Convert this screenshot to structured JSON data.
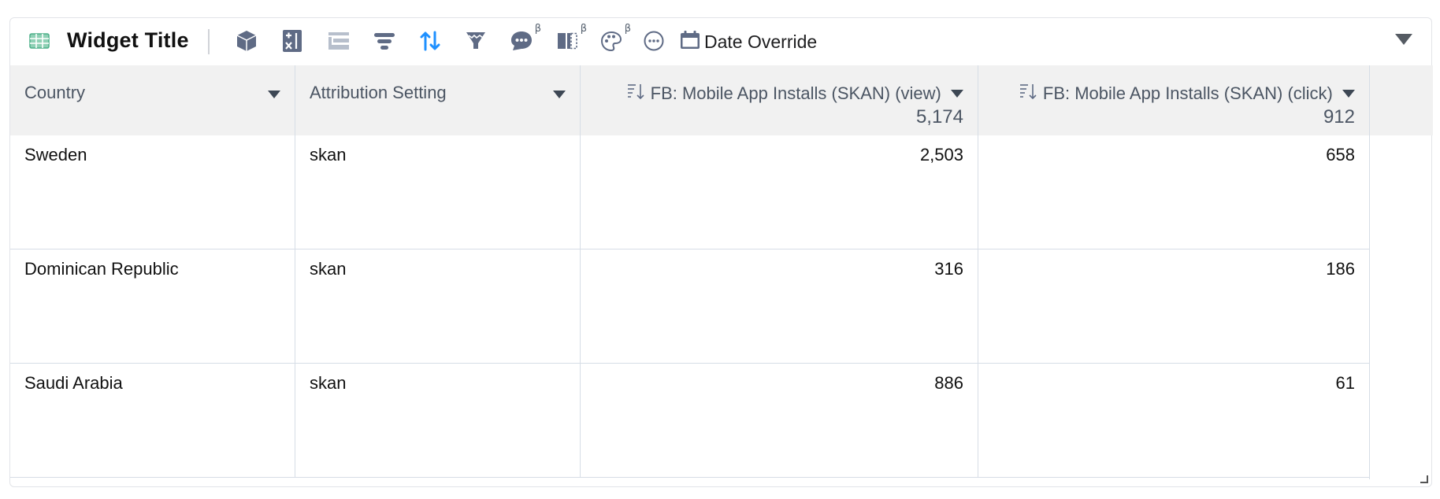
{
  "widget": {
    "title": "Widget Title",
    "title_icon": "table-icon",
    "accent_color": "#4caf88",
    "toolbar": {
      "icons": [
        {
          "name": "cube-icon",
          "beta": false
        },
        {
          "name": "calculator-icon",
          "beta": false
        },
        {
          "name": "layout-icon",
          "beta": false,
          "disabled": true
        },
        {
          "name": "filter-icon",
          "beta": false
        },
        {
          "name": "sort-arrows-icon",
          "beta": false,
          "active": true,
          "color": "#1e90ff"
        },
        {
          "name": "funnel-icon",
          "beta": false
        },
        {
          "name": "chat-icon",
          "beta": true
        },
        {
          "name": "split-panel-icon",
          "beta": true
        },
        {
          "name": "palette-icon",
          "beta": true
        },
        {
          "name": "more-icon",
          "beta": false
        }
      ],
      "beta_label": "β",
      "date_override_label": "Date Override",
      "date_override_icon": "calendar-icon"
    }
  },
  "table": {
    "columns": [
      {
        "label": "Country",
        "align": "left",
        "total": null,
        "sortable_icon": false
      },
      {
        "label": "Attribution Setting",
        "align": "left",
        "total": null,
        "sortable_icon": false
      },
      {
        "label": "FB: Mobile App Installs (SKAN) (view)",
        "align": "right",
        "total": "5,174",
        "sortable_icon": true
      },
      {
        "label": "FB: Mobile App Installs (SKAN) (click)",
        "align": "right",
        "total": "912",
        "sortable_icon": true
      }
    ],
    "rows": [
      [
        "Sweden",
        "skan",
        "2,503",
        "658"
      ],
      [
        "Dominican Republic",
        "skan",
        "316",
        "186"
      ],
      [
        "Saudi Arabia",
        "skan",
        "886",
        "61"
      ]
    ]
  }
}
